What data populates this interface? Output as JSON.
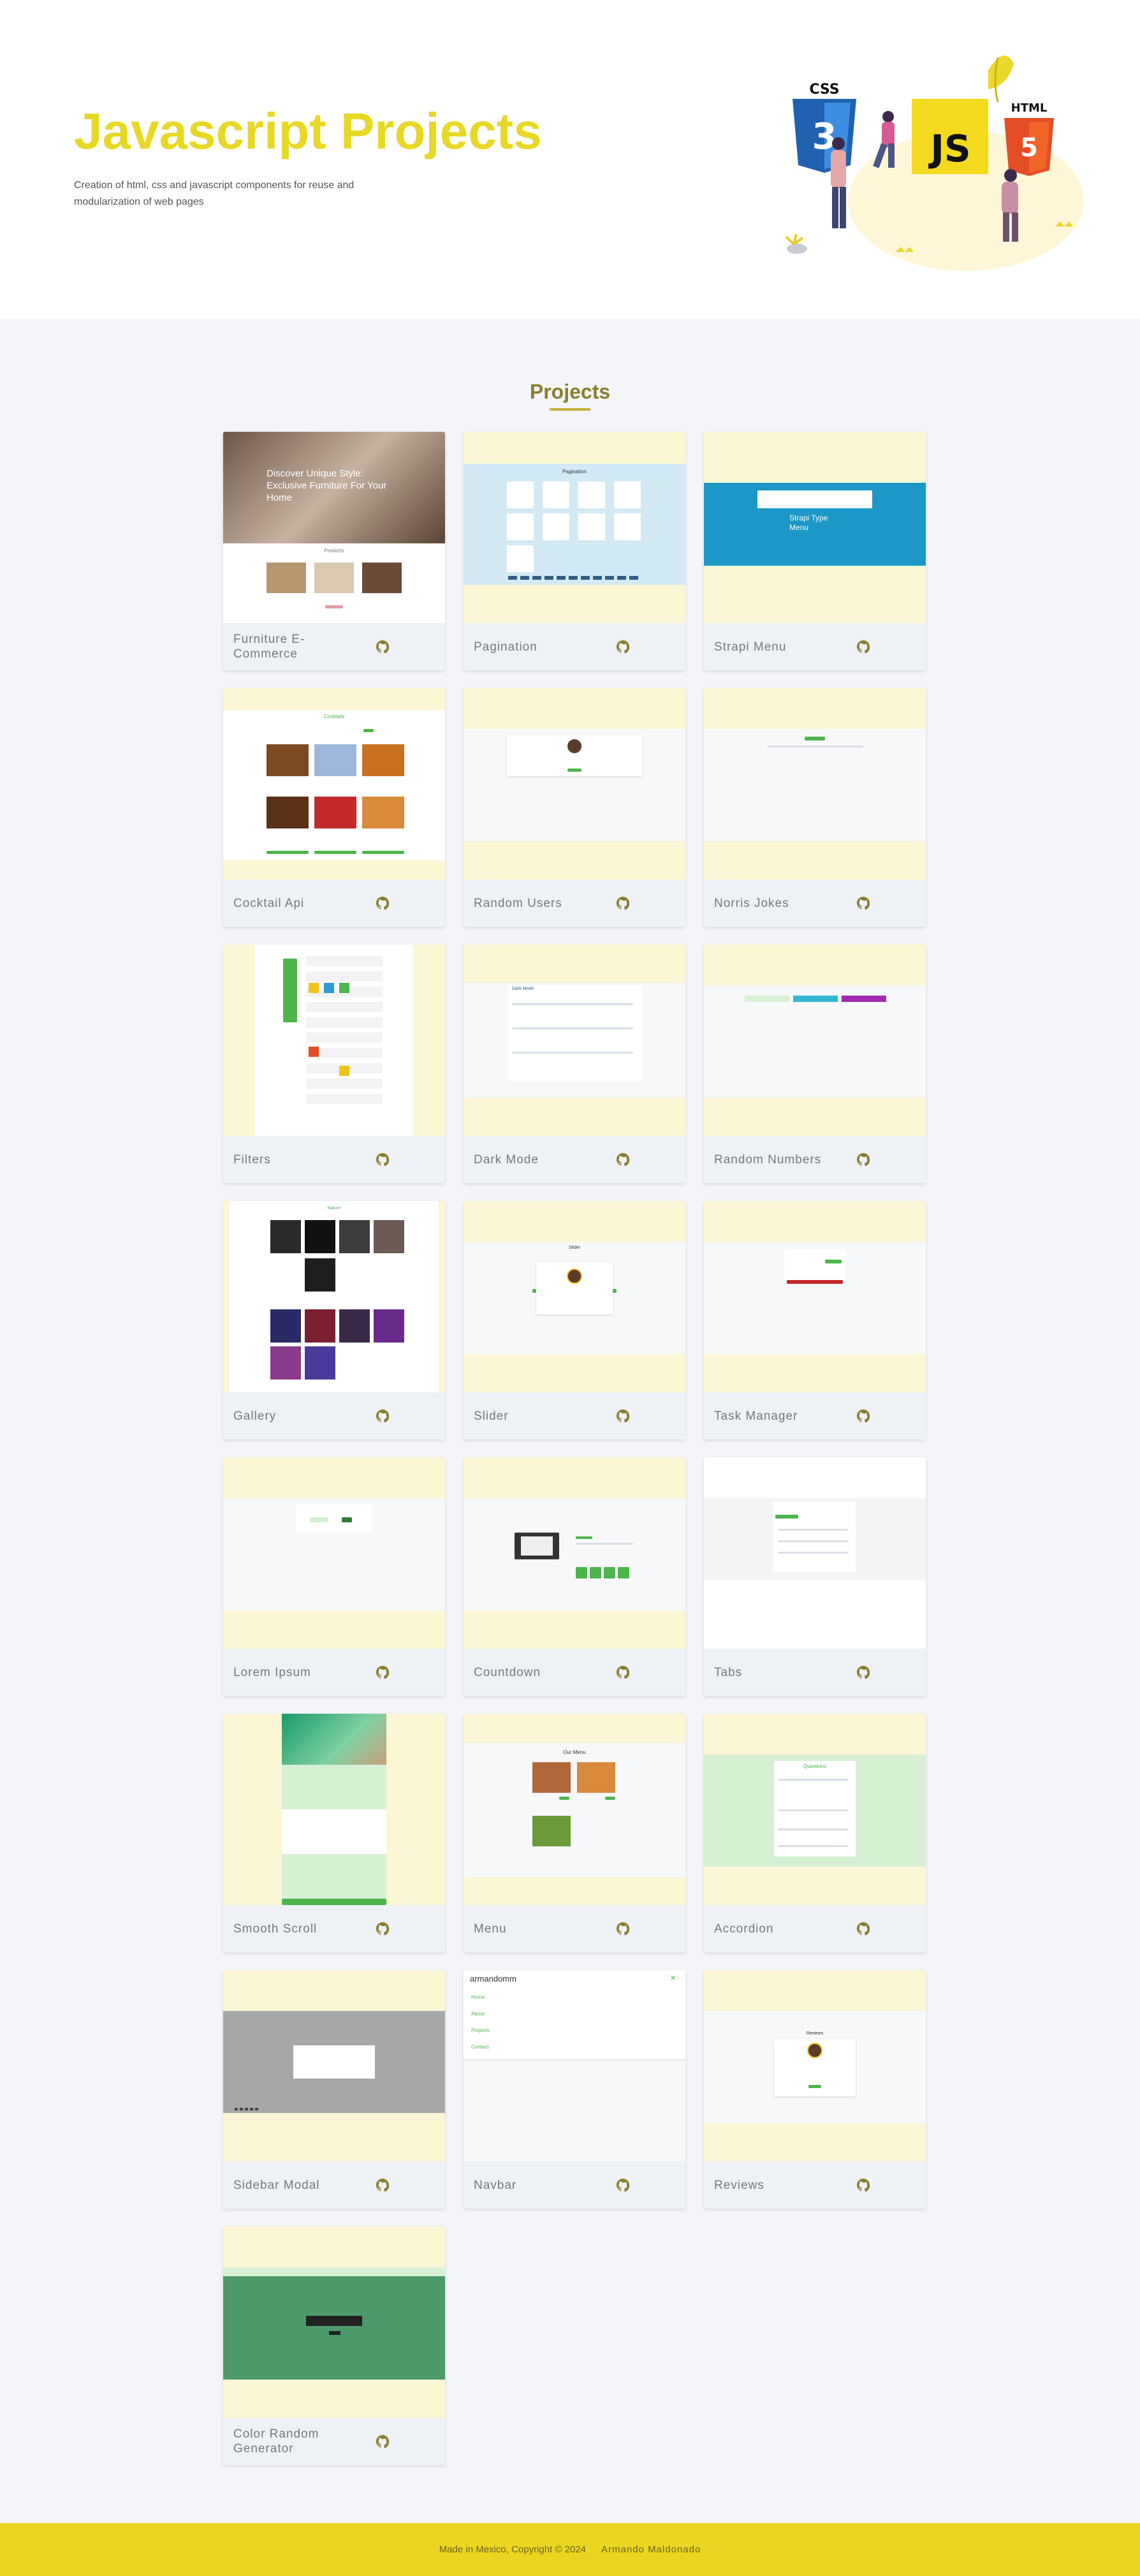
{
  "hero": {
    "title": "Javascript Projects",
    "description": "Creation of html, css and javascript components for reuse and modularization of web pages",
    "art_labels": {
      "css": "CSS",
      "js": "JS",
      "html": "HTML"
    }
  },
  "projects_section": {
    "title": "Projects",
    "items": [
      {
        "name": "Furniture E-Commerce",
        "thumb_text": "Discover Unique Style: Exclusive Furniture For Your Home",
        "thumb_sub": "Products",
        "icon": "github-icon"
      },
      {
        "name": "Pagination",
        "thumb_text": "Pagination",
        "icon": "github-icon"
      },
      {
        "name": "Strapi Menu",
        "thumb_text": "Strapi Type Menu",
        "icon": "github-icon"
      },
      {
        "name": "Cocktail Api",
        "thumb_text": "Cocktails",
        "icon": "github-icon"
      },
      {
        "name": "Random Users",
        "icon": "github-icon"
      },
      {
        "name": "Norris Jokes",
        "icon": "github-icon"
      },
      {
        "name": "Filters",
        "icon": "github-icon"
      },
      {
        "name": "Dark Mode",
        "thumb_text": "Dark Mode",
        "icon": "github-icon"
      },
      {
        "name": "Random Numbers",
        "icon": "github-icon"
      },
      {
        "name": "Gallery",
        "thumb_text": "Nature",
        "icon": "github-icon"
      },
      {
        "name": "Slider",
        "thumb_text": "Slider",
        "icon": "github-icon"
      },
      {
        "name": "Task Manager",
        "icon": "github-icon"
      },
      {
        "name": "Lorem Ipsum",
        "icon": "github-icon"
      },
      {
        "name": "Countdown",
        "icon": "github-icon"
      },
      {
        "name": "Tabs",
        "icon": "github-icon"
      },
      {
        "name": "Smooth Scroll",
        "icon": "github-icon"
      },
      {
        "name": "Menu",
        "thumb_text": "Our Menu",
        "icon": "github-icon"
      },
      {
        "name": "Accordion",
        "thumb_text": "Questions",
        "icon": "github-icon"
      },
      {
        "name": "Sidebar Modal",
        "icon": "github-icon"
      },
      {
        "name": "Navbar",
        "thumb_text": "armandomm",
        "thumb_links": [
          "Home",
          "About",
          "Projects",
          "Contact"
        ],
        "icon": "github-icon"
      },
      {
        "name": "Reviews",
        "thumb_text": "Reviews",
        "icon": "github-icon"
      },
      {
        "name": "Color Random Generator",
        "icon": "github-icon"
      }
    ]
  },
  "footer": {
    "text": "Made in Mexico, Copyright © 2024",
    "author": "Armando Maldonado"
  },
  "colors": {
    "accent": "#e8d826",
    "heading": "#8a7d2c",
    "footer_bg": "#ead520",
    "thumb_bg": "#fbf6d3"
  }
}
